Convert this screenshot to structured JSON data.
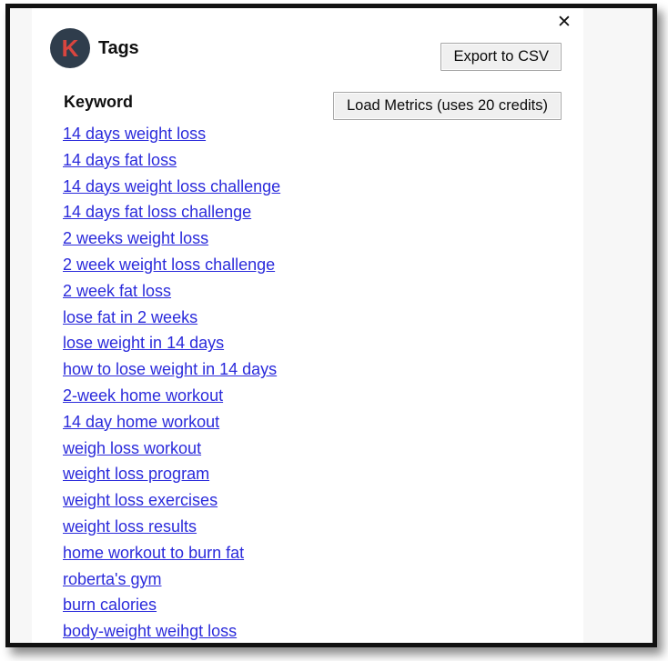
{
  "window": {
    "close_label": "✕"
  },
  "header": {
    "logo_letter": "K",
    "logo_bg": "#2f3d4c",
    "logo_fg": "#d9453f",
    "title": "Tags"
  },
  "toolbar": {
    "export_csv_label": "Export to CSV",
    "load_metrics_label": "Load Metrics (uses 20 credits)"
  },
  "table": {
    "column_header": "Keyword",
    "link_color": "#2b2bdb",
    "keywords": [
      "14 days weight loss",
      "14 days fat loss",
      "14 days weight loss challenge",
      "14 days fat loss challenge",
      "2 weeks weight loss",
      "2 week weight loss challenge",
      "2 week fat loss",
      "lose fat in 2 weeks",
      "lose weight in 14 days",
      "how to lose weight in 14 days",
      "2-week home workout",
      "14 day home workout",
      "weigh loss workout",
      "weight loss program",
      "weight loss exercises",
      "weight loss results",
      "home workout to burn fat",
      "roberta's gym",
      "burn calories",
      "body-weight weihgt loss"
    ]
  }
}
